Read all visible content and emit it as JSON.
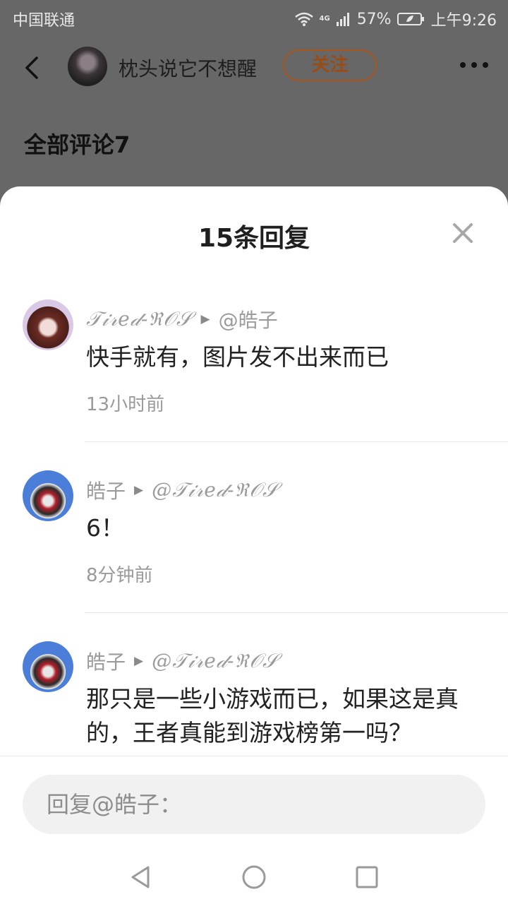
{
  "status_bar": {
    "carrier": "中国联通",
    "network_label": "4G",
    "battery_percent": "57%",
    "time": "上午9:26"
  },
  "topbar": {
    "author_name": "枕头说它不想醒",
    "follow_label": "关注",
    "icons": [
      "back-arrow-icon",
      "more-dots-icon"
    ]
  },
  "background": {
    "comments_heading": "全部评论7"
  },
  "sheet": {
    "title": "15条回复",
    "replies": [
      {
        "author": "𝒯𝒾𝓇𝑒𝒹-ℜ𝒪𝒮",
        "reply_to": "@皓子",
        "text": "快手就有，图片发不出来而已",
        "time": "13小时前"
      },
      {
        "author": "皓子",
        "reply_to": "@𝒯𝒾𝓇𝑒𝒹-ℜ𝒪𝒮",
        "text": "6！",
        "time": "8分钟前"
      },
      {
        "author": "皓子",
        "reply_to": "@𝒯𝒾𝓇𝑒𝒹-ℜ𝒪𝒮",
        "text": "那只是一些小游戏而已，如果这是真的，王者真能到游戏榜第一吗？",
        "time": ""
      }
    ],
    "input_placeholder": "回复@皓子："
  },
  "colors": {
    "follow_accent": "#9a4c16",
    "dim_overlay": "#676767",
    "sheet_bg": "#ffffff"
  }
}
